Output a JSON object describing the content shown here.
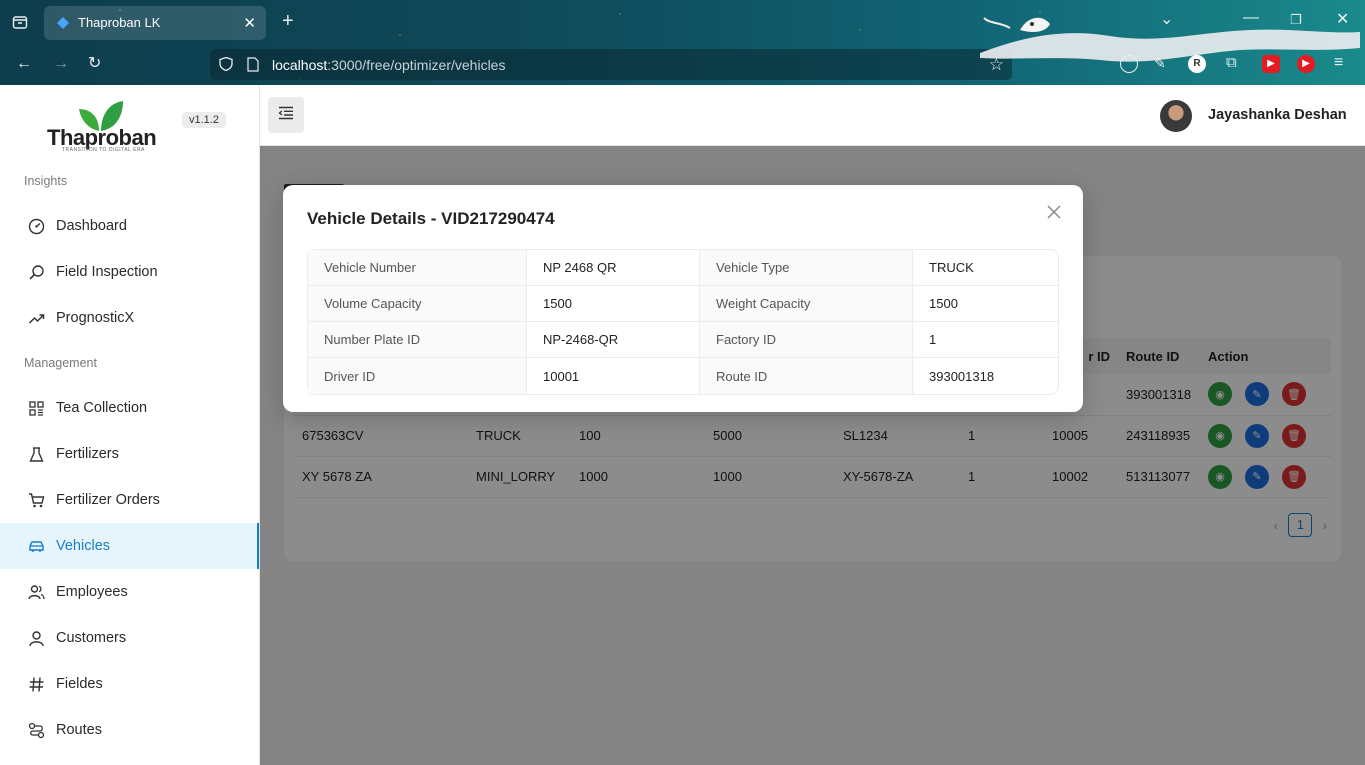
{
  "browser": {
    "tab_title": "Thaproban LK",
    "url_host": "localhost",
    "url_path": ":3000/free/optimizer/vehicles"
  },
  "sidebar": {
    "brand": "Thaproban",
    "tagline": "TRANSITION TO DIGITAL ERA",
    "version": "v1.1.2",
    "sections": {
      "insights": "Insights",
      "management": "Management"
    },
    "items": [
      {
        "label": "Dashboard",
        "icon": "dashboard-icon"
      },
      {
        "label": "Field Inspection",
        "icon": "search-icon"
      },
      {
        "label": "PrognosticX",
        "icon": "trend-icon"
      },
      {
        "label": "Tea Collection",
        "icon": "grid-icon"
      },
      {
        "label": "Fertilizers",
        "icon": "flask-icon"
      },
      {
        "label": "Fertilizer Orders",
        "icon": "cart-icon"
      },
      {
        "label": "Vehicles",
        "icon": "car-icon",
        "active": true
      },
      {
        "label": "Employees",
        "icon": "team-icon"
      },
      {
        "label": "Customers",
        "icon": "user-icon"
      },
      {
        "label": "Fieldes",
        "icon": "hash-icon"
      },
      {
        "label": "Routes",
        "icon": "route-icon"
      }
    ]
  },
  "topbar": {
    "user_name": "Jayashanka Deshan"
  },
  "table": {
    "headers": [
      "",
      "",
      "",
      "",
      "",
      "",
      "r ID",
      "Route ID",
      "Action"
    ],
    "rows": [
      [
        "",
        "",
        "",
        "",
        "",
        "",
        "",
        "393001318"
      ],
      [
        "675363CV",
        "TRUCK",
        "100",
        "5000",
        "SL1234",
        "1",
        "10005",
        "243118935"
      ],
      [
        "XY 5678 ZA",
        "MINI_LORRY",
        "1000",
        "1000",
        "XY-5678-ZA",
        "1",
        "10002",
        "513113077"
      ]
    ],
    "current_page": "1"
  },
  "modal": {
    "title": "Vehicle Details - VID217290474",
    "rows": [
      {
        "l1": "Vehicle Number",
        "v1": "NP 2468 QR",
        "l2": "Vehicle Type",
        "v2": "TRUCK"
      },
      {
        "l1": "Volume Capacity",
        "v1": "1500",
        "l2": "Weight Capacity",
        "v2": "1500"
      },
      {
        "l1": "Number Plate ID",
        "v1": "NP-2468-QR",
        "l2": "Factory ID",
        "v2": "1"
      },
      {
        "l1": "Driver ID",
        "v1": "10001",
        "l2": "Route ID",
        "v2": "393001318"
      }
    ]
  },
  "colors": {
    "accent": "#1a7ec8",
    "view": "#2f9e44",
    "edit": "#1c6fe0",
    "delete": "#e03131"
  }
}
